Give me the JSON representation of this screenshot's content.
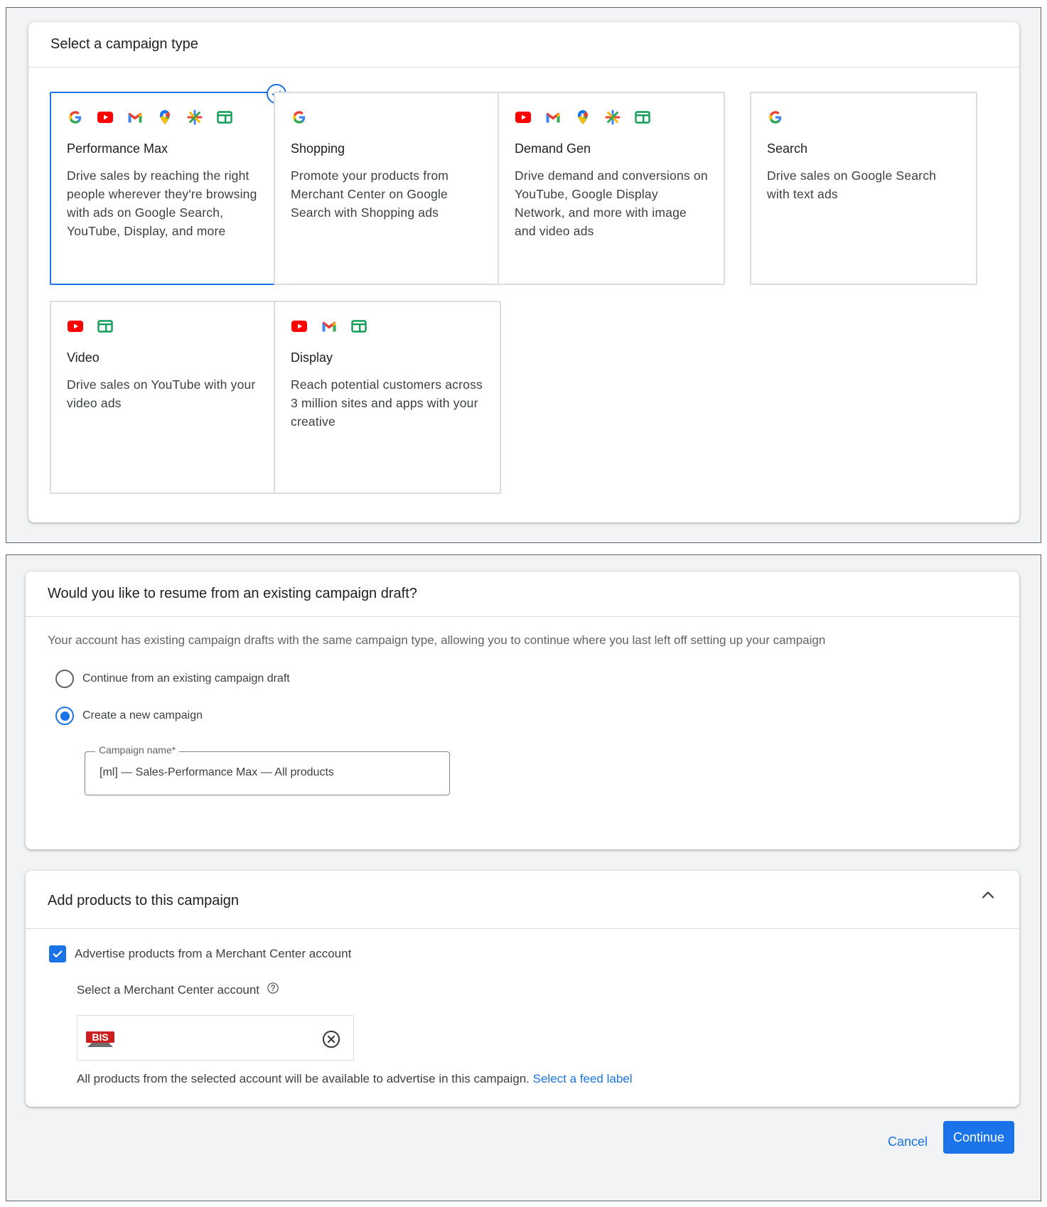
{
  "campaign_type": {
    "header": "Select a campaign type",
    "tiles": [
      {
        "title": "Performance Max",
        "description": "Drive sales by reaching the right people wherever they're browsing with ads on Google Search, YouTube, Display, and more",
        "icons": [
          "google-g-icon",
          "youtube-icon",
          "gmail-icon",
          "maps-pin-icon",
          "discover-icon",
          "display-icon"
        ],
        "selected": true
      },
      {
        "title": "Shopping",
        "description": "Promote your products from Merchant Center on Google Search with Shopping ads",
        "icons": [
          "google-g-icon"
        ]
      },
      {
        "title": "Demand Gen",
        "description": "Drive demand and conversions on YouTube, Google Display Network, and more with image and video ads",
        "icons": [
          "youtube-icon",
          "gmail-icon",
          "maps-pin-icon",
          "discover-icon",
          "display-icon"
        ]
      },
      {
        "title": "Search",
        "description": "Drive sales on Google Search with text ads",
        "icons": [
          "google-g-icon"
        ]
      },
      {
        "title": "Video",
        "description": "Drive sales on YouTube with your video ads",
        "icons": [
          "youtube-icon",
          "display-icon"
        ]
      },
      {
        "title": "Display",
        "description": "Reach potential customers across 3 million sites and apps with your creative",
        "icons": [
          "youtube-icon",
          "gmail-icon",
          "display-icon"
        ]
      }
    ]
  },
  "draft": {
    "header": "Would you like to resume from an existing campaign draft?",
    "subtext": "Your account has existing campaign drafts with the same campaign type, allowing you to continue where you last left off setting up your campaign",
    "options": [
      {
        "label": "Continue from an existing campaign draft",
        "selected": false
      },
      {
        "label": "Create a new campaign",
        "selected": true
      }
    ],
    "campaign_name": {
      "label": "Campaign name*",
      "value": "[ml] — Sales-Performance Max — All products"
    }
  },
  "products": {
    "header": "Add products to this campaign",
    "checkbox_label": "Advertise products from a Merchant Center account",
    "checkbox_checked": true,
    "select_label": "Select a Merchant Center account",
    "logo_text": "BIS",
    "note": "All products from the selected account will be available to advertise in this campaign.",
    "link": "Select a feed label"
  },
  "actions": {
    "cancel": "Cancel",
    "continue": "Continue"
  },
  "colors": {
    "accent": "#1a73e8",
    "panel_bg": "#f1f3f4",
    "border": "#dadce0"
  }
}
